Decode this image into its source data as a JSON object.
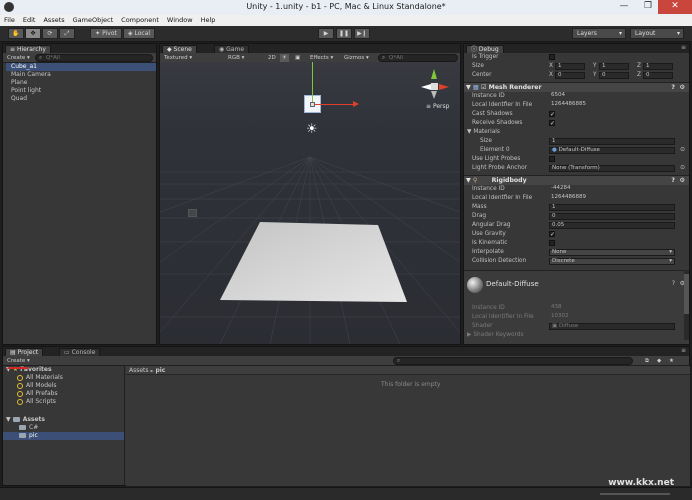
{
  "window": {
    "title": "Unity - 1.unity - b1 - PC, Mac & Linux Standalone*",
    "minimize": "—",
    "maximize": "❐",
    "close": "✕"
  },
  "menubar": [
    "File",
    "Edit",
    "Assets",
    "GameObject",
    "Component",
    "Window",
    "Help"
  ],
  "toolbar": {
    "pivot": "Pivot",
    "local": "Local",
    "layers": "Layers",
    "layout": "Layout"
  },
  "hierarchy": {
    "tab": "Hierarchy",
    "create": "Create",
    "search_placeholder": "Q*All",
    "items": [
      "Cube_a1",
      "Main Camera",
      "Plane",
      "Point light",
      "Quad"
    ],
    "selected_index": 0
  },
  "scene": {
    "tab_scene": "Scene",
    "tab_game": "Game",
    "shading": "Textured",
    "mode": "RGB",
    "twod": "2D",
    "effects": "Effects",
    "gizmos": "Gizmos",
    "search_placeholder": "Q*All",
    "persp": "Persp"
  },
  "inspector": {
    "tab": "Debug",
    "rows_top": [
      {
        "label": "Is Trigger",
        "type": "check",
        "value": ""
      },
      {
        "label": "Size",
        "type": "xyz",
        "x": "1",
        "y": "1",
        "z": "1"
      },
      {
        "label": "Center",
        "type": "xyz",
        "x": "0",
        "y": "0",
        "z": "0"
      }
    ],
    "mesh_renderer": {
      "title": "Mesh Renderer",
      "rows": [
        {
          "label": "Instance ID",
          "value": "6504"
        },
        {
          "label": "Local Identfier In File",
          "value": "1264486885"
        },
        {
          "label": "Cast Shadows",
          "check": "✓"
        },
        {
          "label": "Receive Shadows",
          "check": "✓"
        },
        {
          "label": "Materials",
          "value": ""
        },
        {
          "label": "Size",
          "value": "1"
        },
        {
          "label": "Element 0",
          "value": "Default-Diffuse"
        },
        {
          "label": "Use Light Probes",
          "check": ""
        },
        {
          "label": "Light Probe Anchor",
          "value": "None (Transform)"
        }
      ]
    },
    "rigidbody": {
      "title": "Rigidbody",
      "rows": [
        {
          "label": "Instance ID",
          "value": "-44284"
        },
        {
          "label": "Local Identfier In File",
          "value": "1264486889"
        },
        {
          "label": "Mass",
          "value": "1"
        },
        {
          "label": "Drag",
          "value": "0"
        },
        {
          "label": "Angular Drag",
          "value": "0.05"
        },
        {
          "label": "Use Gravity",
          "check": "✓"
        },
        {
          "label": "Is Kinematic",
          "check": ""
        },
        {
          "label": "Interpolate",
          "value": "None"
        },
        {
          "label": "Collision Detection",
          "value": "Discrete"
        }
      ]
    },
    "material": {
      "title": "Default-Diffuse",
      "rows": [
        {
          "label": "Instance ID",
          "value": "438"
        },
        {
          "label": "Local Identifier In File",
          "value": "10302"
        },
        {
          "label": "Shader",
          "value": "Diffuse"
        },
        {
          "label": "Shader Keywords",
          "value": ""
        }
      ]
    }
  },
  "project": {
    "tab_project": "Project",
    "tab_console": "Console",
    "create": "Create",
    "favorites": "Favorites",
    "fav_items": [
      "All Materials",
      "All Models",
      "All Prefabs",
      "All Scripts"
    ],
    "assets": "Assets",
    "asset_items": [
      "C#",
      "pic"
    ],
    "breadcrumb_root": "Assets",
    "breadcrumb_sep": "►",
    "breadcrumb_current": "pic",
    "empty_text": "This folder is empty"
  },
  "watermark": "www.kkx.net",
  "colors": {
    "selection": "#3b4f77",
    "x_axis": "#e0402a",
    "y_axis": "#7dc83a",
    "z_axis": "#3a6fd8"
  }
}
